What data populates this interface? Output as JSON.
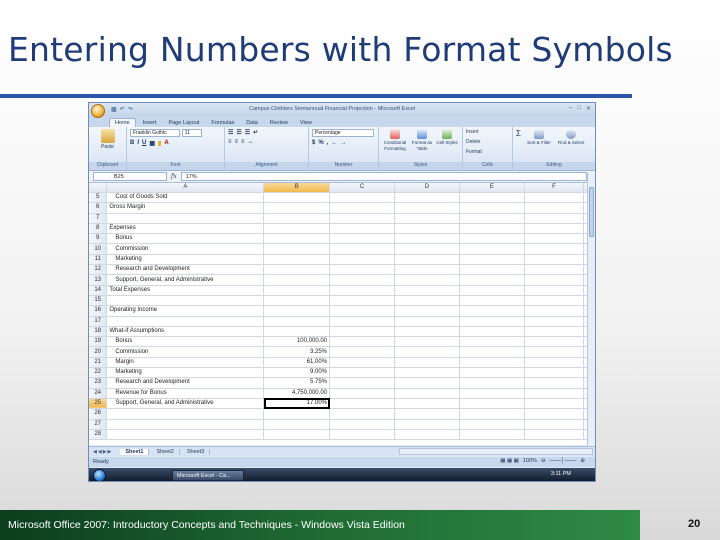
{
  "slide": {
    "title": "Entering Numbers with Format Symbols",
    "footer": "Microsoft Office 2007: Introductory Concepts and Techniques - Windows Vista Edition",
    "page_number": "20"
  },
  "excel": {
    "window_title": "Campus Clothiers Semiannual Financial Projection - Microsoft Excel",
    "tabs": [
      "Home",
      "Insert",
      "Page Layout",
      "Formulas",
      "Data",
      "Review",
      "View"
    ],
    "active_tab": "Home",
    "ribbon": {
      "clipboard": {
        "label": "Clipboard",
        "paste": "Paste"
      },
      "font": {
        "label": "Font",
        "name": "Franklin Gothic",
        "size": "11",
        "bold": "B",
        "italic": "I",
        "underline": "U"
      },
      "alignment": {
        "label": "Alignment"
      },
      "number": {
        "label": "Number",
        "format": "Percentage",
        "currency": "$",
        "percent": "%",
        "comma": ","
      },
      "styles": {
        "label": "Styles",
        "conditional": "Conditional Formatting",
        "format_table": "Format as Table",
        "cell_styles": "Cell Styles"
      },
      "cells": {
        "label": "Cells",
        "insert": "Insert",
        "delete": "Delete",
        "format": "Format"
      },
      "editing": {
        "label": "Editing",
        "sort": "Sort & Filter",
        "find": "Find & Select",
        "sum": "Σ"
      }
    },
    "name_box": "B25",
    "formula_value": "17%",
    "columns": [
      "A",
      "B",
      "C",
      "D",
      "E",
      "F"
    ],
    "selected_column": "B",
    "rows": [
      {
        "num": "5",
        "a": "Cost of Goods Sold",
        "b": "",
        "indent": true
      },
      {
        "num": "6",
        "a": "Gross Margin",
        "b": "",
        "indent": false
      },
      {
        "num": "7",
        "a": "",
        "b": "",
        "indent": false
      },
      {
        "num": "8",
        "a": "Expenses",
        "b": "",
        "indent": false
      },
      {
        "num": "9",
        "a": "Bonus",
        "b": "",
        "indent": true
      },
      {
        "num": "10",
        "a": "Commission",
        "b": "",
        "indent": true
      },
      {
        "num": "11",
        "a": "Marketing",
        "b": "",
        "indent": true
      },
      {
        "num": "12",
        "a": "Research and Development",
        "b": "",
        "indent": true
      },
      {
        "num": "13",
        "a": "Support, General, and Administrative",
        "b": "",
        "indent": true
      },
      {
        "num": "14",
        "a": "Total Expenses",
        "b": "",
        "indent": false
      },
      {
        "num": "15",
        "a": "",
        "b": "",
        "indent": false
      },
      {
        "num": "16",
        "a": "Operating Income",
        "b": "",
        "indent": false
      },
      {
        "num": "17",
        "a": "",
        "b": "",
        "indent": false
      },
      {
        "num": "18",
        "a": "What-if Assumptions",
        "b": "",
        "indent": false
      },
      {
        "num": "19",
        "a": "Bonus",
        "b": "100,000.00",
        "indent": true
      },
      {
        "num": "20",
        "a": "Commission",
        "b": "3.25%",
        "indent": true
      },
      {
        "num": "21",
        "a": "Margin",
        "b": "61.00%",
        "indent": true
      },
      {
        "num": "22",
        "a": "Marketing",
        "b": "9.00%",
        "indent": true
      },
      {
        "num": "23",
        "a": "Research and Development",
        "b": "5.75%",
        "indent": true
      },
      {
        "num": "24",
        "a": "Revenue for Bonus",
        "b": "4,750,000.00",
        "indent": true
      },
      {
        "num": "25",
        "a": "Support, General, and Administrative",
        "b": "17.00%",
        "indent": true
      },
      {
        "num": "26",
        "a": "",
        "b": "",
        "indent": false
      },
      {
        "num": "27",
        "a": "",
        "b": "",
        "indent": false
      },
      {
        "num": "28",
        "a": "",
        "b": "",
        "indent": false
      }
    ],
    "active_row": "25",
    "sheets": [
      "Sheet1",
      "Sheet2",
      "Sheet3"
    ],
    "active_sheet": "Sheet1",
    "status": "Ready",
    "zoom": "100%",
    "taskbar_item": "Microsoft Excel - Ca...",
    "clock": "3:11 PM"
  }
}
